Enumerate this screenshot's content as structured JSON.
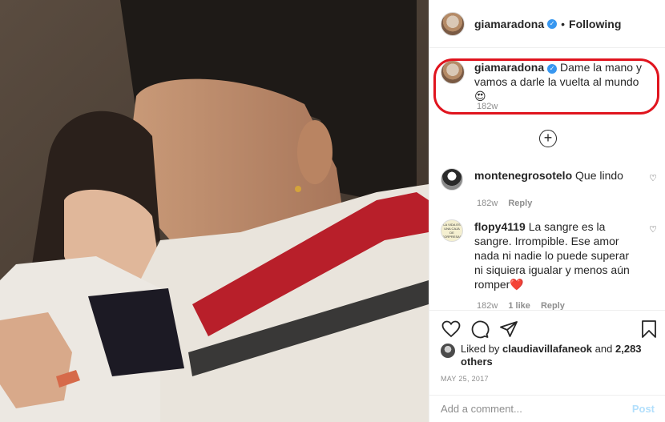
{
  "post_photo": {
    "icon": "photo-father-and-daughter"
  },
  "header": {
    "username": "giamaradona",
    "separator": "•",
    "follow_status": "Following",
    "verified_icon": "verified-badge-icon"
  },
  "caption": {
    "username": "giamaradona",
    "text": "Dame la mano y vamos a darle la vuelta al mundo 😍",
    "time": "182w"
  },
  "load_more_icon": "plus-circle-icon",
  "comments": [
    {
      "username": "montenegrosotelo",
      "text": "Que lindo",
      "time": "182w",
      "reply_label": "Reply"
    },
    {
      "username": "flopy4119",
      "text": "La sangre es la sangre. Irrompible. Ese amor nada ni nadie lo puede superar ni siquiera igualar y menos aún romper❤️",
      "time": "182w",
      "likes_label": "1 like",
      "reply_label": "Reply",
      "avatar_text": "LA VIDA ES UNA CAJA DE SORPRESAS"
    }
  ],
  "actions": {
    "icons": [
      "heart-icon",
      "comment-icon",
      "share-icon",
      "bookmark-icon"
    ]
  },
  "likes": {
    "prefix": "Liked by",
    "user": "claudiavillafaneok",
    "and": "and",
    "others": "2,283 others"
  },
  "date": "MAY 25, 2017",
  "add_comment": {
    "placeholder": "Add a comment...",
    "post_label": "Post"
  },
  "colors": {
    "highlight": "#e0141e",
    "verified": "#3897f0",
    "post_disabled": "#b2dffc"
  }
}
